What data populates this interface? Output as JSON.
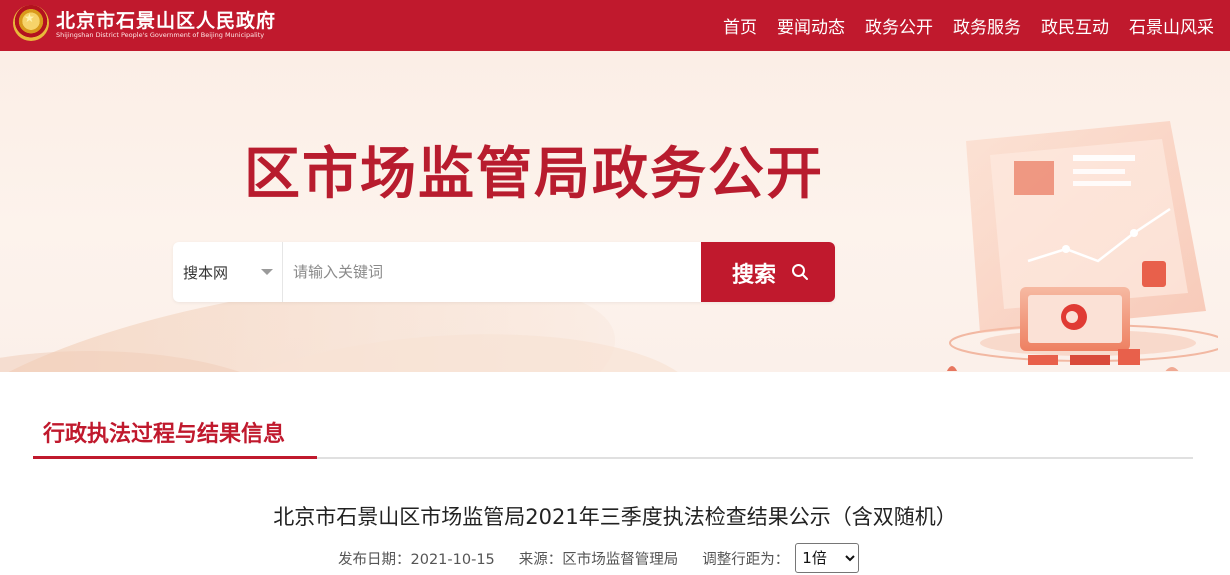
{
  "header": {
    "site_title": "北京市石景山区人民政府",
    "site_subtitle": "Shijingshan District People's Government of Beijing Municipality",
    "nav": [
      "首页",
      "要闻动态",
      "政务公开",
      "政务服务",
      "政民互动",
      "石景山风采"
    ]
  },
  "banner": {
    "title": "区市场监管局政务公开",
    "search": {
      "scope": "搜本网",
      "placeholder": "请输入关键词",
      "button_label": "搜索"
    }
  },
  "section": {
    "title": "行政执法过程与结果信息"
  },
  "article": {
    "title": "北京市石景山区市场监管局2021年三季度执法检查结果公示（含双随机）",
    "publish_date": "发布日期：2021-10-15",
    "source": "来源：区市场监督管理局",
    "line_height_label": "调整行距为：",
    "line_height_value": "1倍"
  },
  "colors": {
    "brand_red": "#c0192d",
    "title_red": "#b81c2e"
  }
}
